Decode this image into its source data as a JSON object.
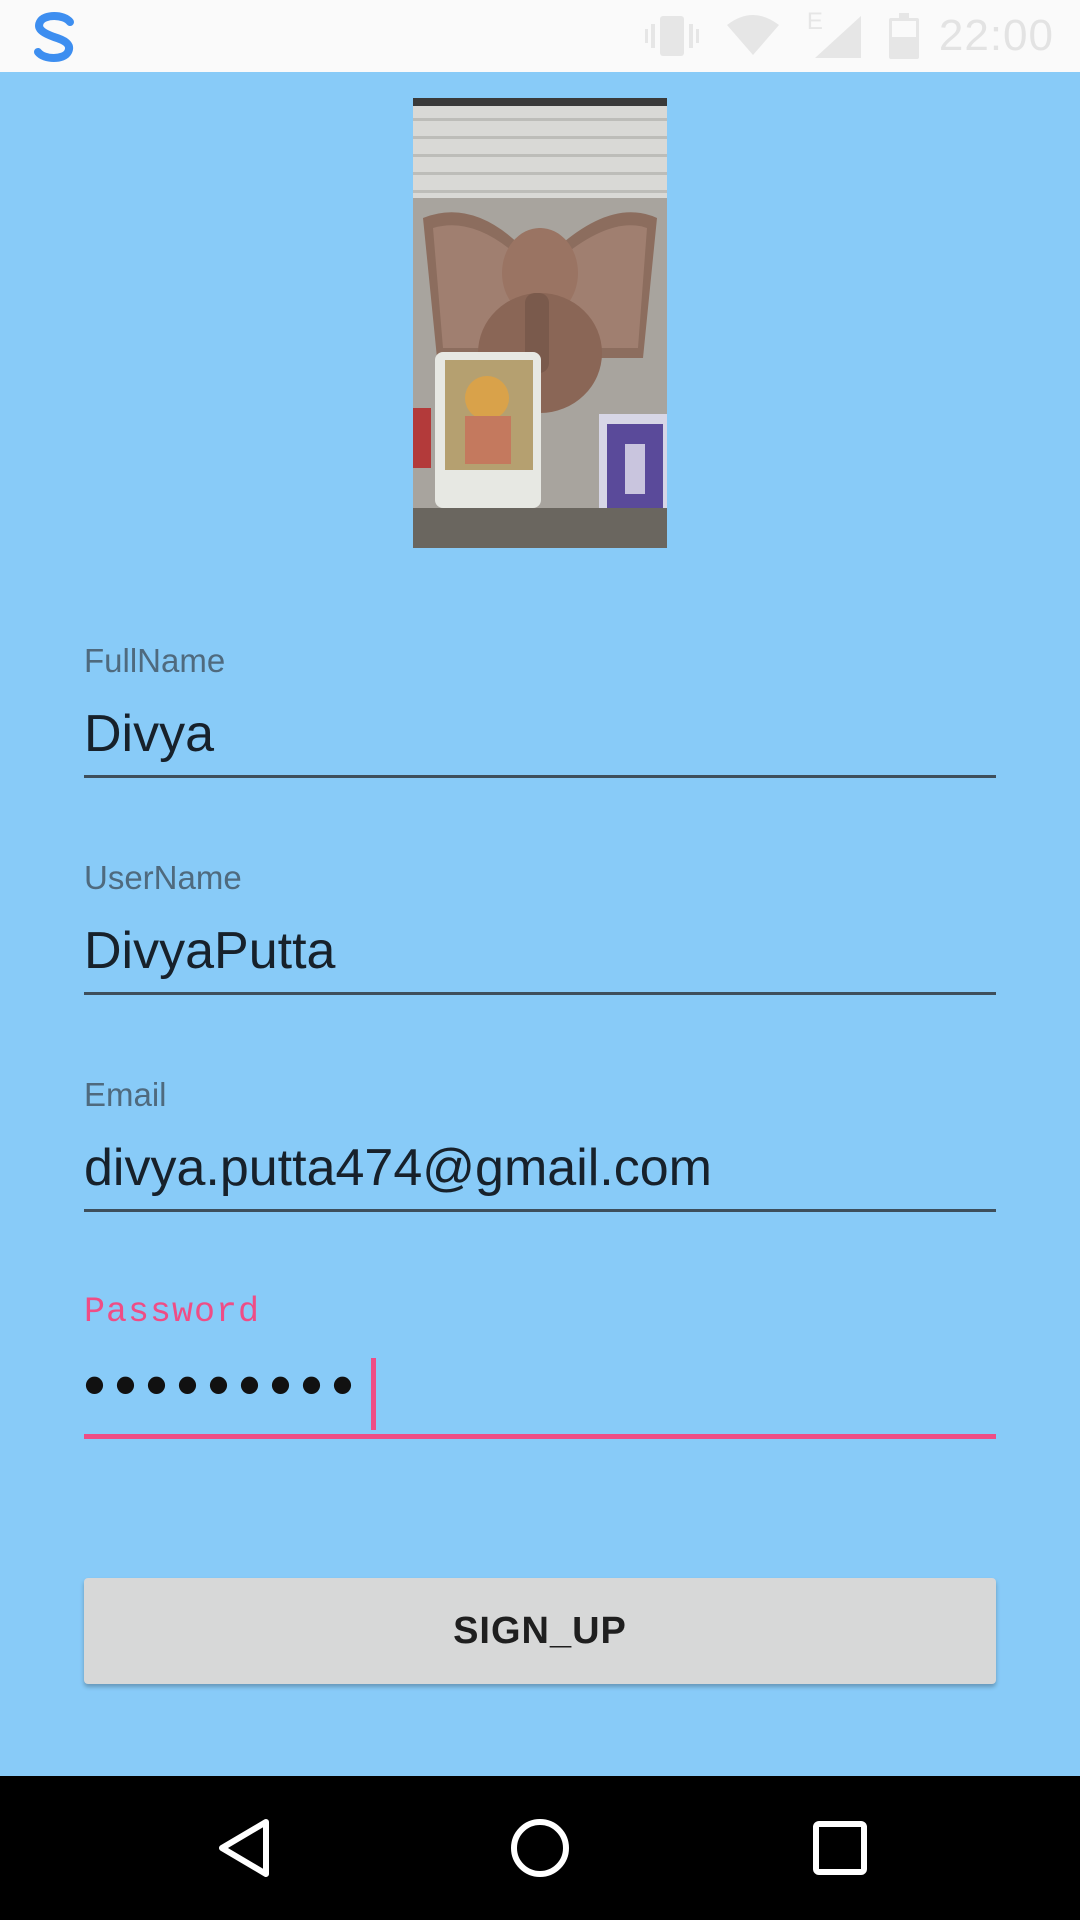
{
  "status_bar": {
    "time": "22:00",
    "network_letter": "E",
    "icons": [
      "app-logo-icon",
      "vibrate-icon",
      "wifi-icon",
      "signal-icon",
      "battery-icon"
    ]
  },
  "profile": {
    "photo_icon": "profile-photo"
  },
  "form": {
    "fullname": {
      "label": "FullName",
      "value": "Divya"
    },
    "username": {
      "label": "UserName",
      "value": "DivyaPutta"
    },
    "email": {
      "label": "Email",
      "value": "divya.putta474@gmail.com"
    },
    "password": {
      "label": "Password",
      "value": "•••••••••"
    }
  },
  "actions": {
    "signup_label": "SIGN_UP"
  },
  "navigation": {
    "icons": [
      "back-icon",
      "home-icon",
      "recents-icon"
    ]
  },
  "colors": {
    "background": "#88cbf8",
    "accent": "#ef4d86",
    "button": "#d7d8d8",
    "logo": "#3d8ef0"
  }
}
